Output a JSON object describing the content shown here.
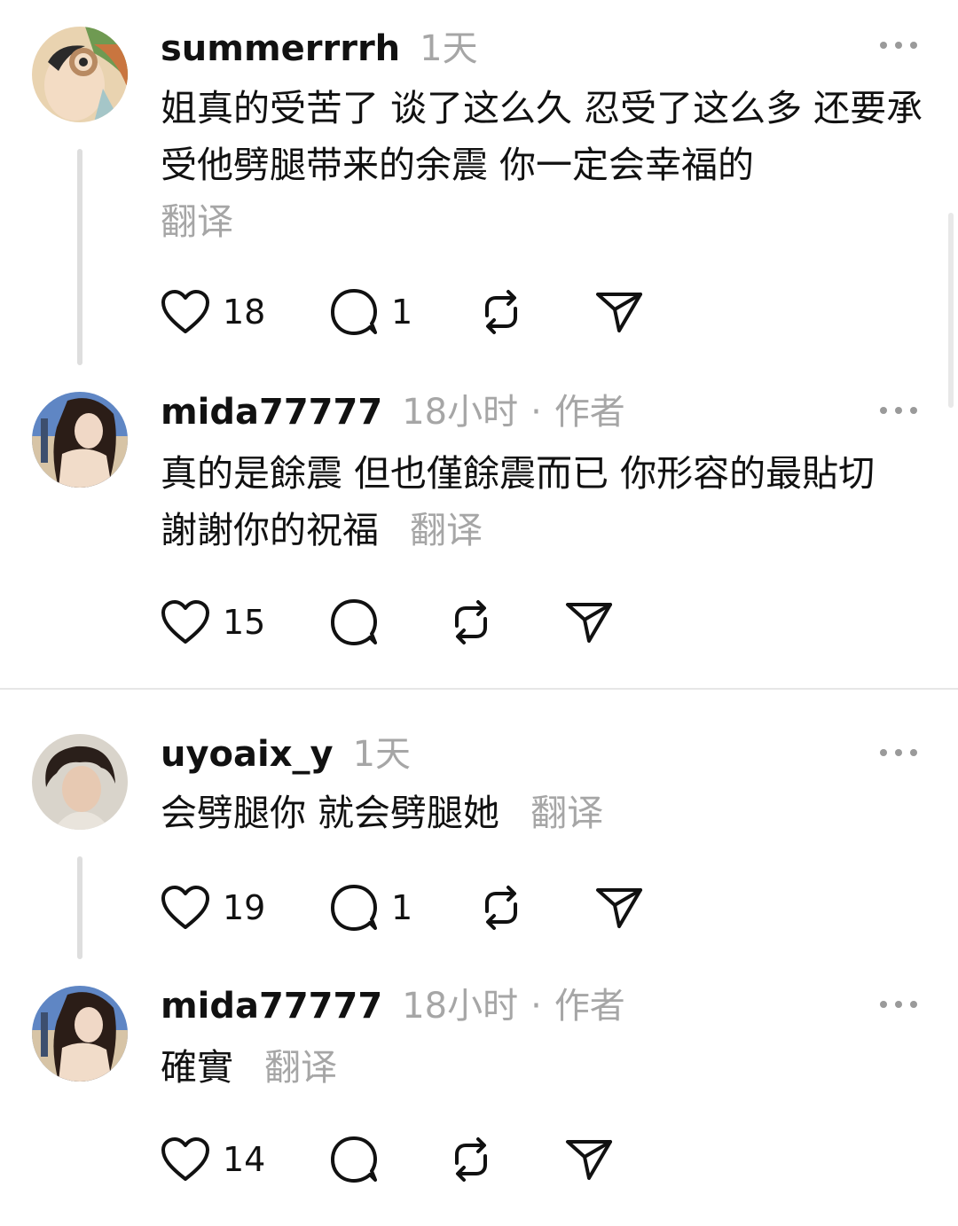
{
  "comments": [
    {
      "username": "summerrrrh",
      "time": "1天",
      "text": "姐真的受苦了 谈了这么久 忍受了这么多 还要承受他劈腿带来的余震 你一定会幸福的",
      "translate": "翻译",
      "likes": "18",
      "replies": "1"
    },
    {
      "username": "mida77777",
      "time": "18小时",
      "separator": "·",
      "author_badge": "作者",
      "text": "真的是餘震 但也僅餘震而已 你形容的最貼切 謝謝你的祝福",
      "translate": "翻译",
      "likes": "15",
      "replies": ""
    },
    {
      "username": "uyoaix_y",
      "time": "1天",
      "text": "会劈腿你 就会劈腿她",
      "translate": "翻译",
      "likes": "19",
      "replies": "1"
    },
    {
      "username": "mida77777",
      "time": "18小时",
      "separator": "·",
      "author_badge": "作者",
      "text": "確實",
      "translate": "翻译",
      "likes": "14",
      "replies": ""
    }
  ],
  "icons": {
    "like": "heart-icon",
    "reply": "speech-bubble-icon",
    "repost": "repost-arrows-icon",
    "share": "paper-plane-icon",
    "more": "more-dots-icon"
  },
  "colors": {
    "text": "#111111",
    "muted": "#a6a6a6",
    "thread_line": "#dedede",
    "divider": "#e6e6e6"
  }
}
